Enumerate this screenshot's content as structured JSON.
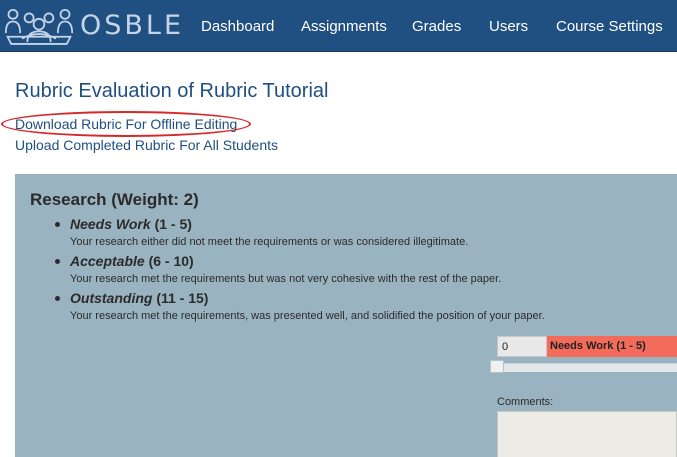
{
  "header": {
    "brand": "OSBLE",
    "logo_icon": "people-group-logo-icon",
    "nav": [
      "Dashboard",
      "Assignments",
      "Grades",
      "Users",
      "Course Settings"
    ],
    "colors": {
      "bar": "#205081",
      "logo_text": "#c5d4e6"
    }
  },
  "main": {
    "title": "Rubric Evaluation of Rubric Tutorial",
    "links": {
      "download": "Download Rubric For Offline Editing",
      "upload": "Upload Completed Rubric For All Students"
    },
    "annotation_color": "#d42a2a"
  },
  "criterion": {
    "title": "Research (Weight: 2)",
    "levels": [
      {
        "name": "Needs Work",
        "range": "(1 - 5)",
        "description": "Your research either did not meet the requirements or was considered illegitimate."
      },
      {
        "name": "Acceptable",
        "range": "(6 - 10)",
        "description": "Your research met the requirements but was not very cohesive with the rest of the paper."
      },
      {
        "name": "Outstanding",
        "range": "(11 - 15)",
        "description": "Your research met the requirements, was presented well, and solidified the position of your paper."
      }
    ],
    "score": "0",
    "score_level": "Needs Work (1 - 5)",
    "comments_label": "Comments:",
    "colors": {
      "panel": "#9ab3c0",
      "level_badge": "#f26b5b"
    }
  }
}
